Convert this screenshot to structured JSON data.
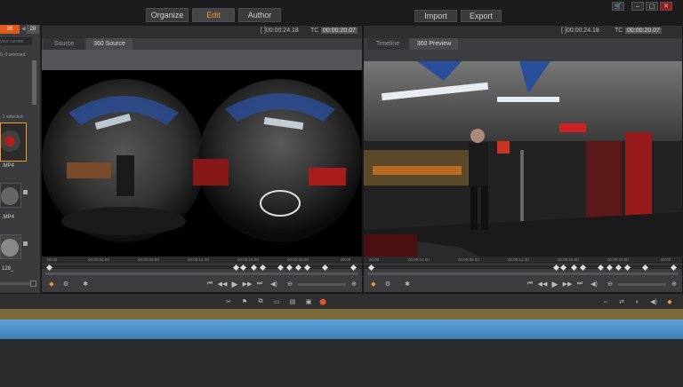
{
  "nav": {
    "organize": "Organize",
    "edit": "Edit",
    "author": "Author",
    "import": "Import",
    "export": "Export"
  },
  "window": {
    "cart": "🛒",
    "minimize": "–",
    "restore": "▢",
    "close": "✕"
  },
  "library": {
    "count_left": "26",
    "count_right": "28",
    "search_placeholder": "your current",
    "selection_top": "0, 0 selected",
    "selection_mid": ", 1 selected",
    "clips": [
      {
        "name": ".MP4"
      },
      {
        "name": ".MP4"
      },
      {
        "name": "128_"
      }
    ]
  },
  "source": {
    "tabs": [
      "Source",
      "360 Source"
    ],
    "duration": "[ ]00:00:24.18",
    "tc_label": "TC",
    "tc_value": "00:00:20.07",
    "ruler": [
      "00.00",
      "00:00:04.00",
      "00:00:08.00",
      "00:00:12.00",
      "00:00:16.00",
      "00:00:20.00",
      "00:00"
    ]
  },
  "preview": {
    "tabs": [
      "Timeline",
      "360 Preview"
    ],
    "duration": "[ ]00:00:24.18",
    "tc_label": "TC",
    "tc_value": "00:00:20.07",
    "ruler": [
      "00.00",
      "00:00:04.00",
      "00:00:08.00",
      "00:00:12.00",
      "00:00:16.00",
      "00:00:20.00",
      "00:00"
    ]
  },
  "accent": "#f39a2a"
}
